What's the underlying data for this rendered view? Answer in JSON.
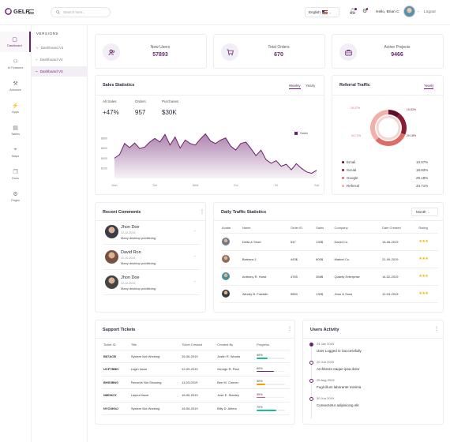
{
  "brand": {
    "name": "GELR",
    "logo_color": "#6b1f6e"
  },
  "header": {
    "search_placeholder": "Search here...",
    "language": "English",
    "greeting": "Hello, Brian C",
    "logout": "Logout"
  },
  "sidebar": {
    "items": [
      {
        "label": "Dashboard",
        "icon": "dashboard-icon",
        "active": true
      },
      {
        "label": "UI Features",
        "icon": "ui-features-icon"
      },
      {
        "label": "Advance",
        "icon": "advance-icon"
      },
      {
        "label": "Apps",
        "icon": "apps-icon"
      },
      {
        "label": "Tables",
        "icon": "tables-icon"
      },
      {
        "label": "Maps",
        "icon": "maps-icon"
      },
      {
        "label": "Docs",
        "icon": "docs-icon"
      },
      {
        "label": "Pages",
        "icon": "pages-icon"
      }
    ],
    "sub_title": "VERSIONS",
    "sub_items": [
      {
        "label": "Dashboard V1"
      },
      {
        "label": "Dashboard V2"
      },
      {
        "label": "Dashboard V3",
        "active": true
      }
    ]
  },
  "stats": [
    {
      "label": "New Users",
      "value": "57893",
      "icon": "users-icon"
    },
    {
      "label": "Total Orders",
      "value": "670",
      "icon": "cart-icon"
    },
    {
      "label": "Active Projects",
      "value": "9466",
      "icon": "briefcase-icon"
    }
  ],
  "sales": {
    "title": "Sales Statistics",
    "tabs": [
      "Weekly",
      "Yearly"
    ],
    "metrics": [
      {
        "label": "All Sales",
        "value": "+47%"
      },
      {
        "label": "Orders",
        "value": "957"
      },
      {
        "label": "Purchases",
        "value": "$30K"
      }
    ],
    "legend": "Sales"
  },
  "chart_data": {
    "type": "area",
    "x": [
      "Mon",
      "Tue",
      "Wed",
      "Thu",
      "Fri",
      "Sat"
    ],
    "y_ticks": [
      "$800",
      "$600",
      "$400",
      "$200"
    ],
    "series": [
      {
        "name": "Sales",
        "values": [
          400,
          470,
          690,
          610,
          700,
          590,
          620,
          720,
          790,
          720,
          870,
          660,
          820,
          600,
          760,
          690,
          660,
          780,
          880,
          740,
          690,
          760,
          800,
          640,
          560,
          690,
          720,
          590,
          450,
          560,
          370,
          300,
          350,
          240,
          280,
          170,
          290,
          200,
          130,
          100,
          160
        ]
      }
    ],
    "ylim": [
      0,
      1000
    ],
    "color": "#6b1f6e"
  },
  "referral": {
    "title": "Referral Traffic",
    "tab": "Yearly",
    "items": [
      {
        "label": "Email",
        "value": "10.07%",
        "color": "#5c0f2e"
      },
      {
        "label": "Social",
        "value": "18.83%",
        "color": "#8a1c35"
      },
      {
        "label": "Google",
        "value": "29.18%",
        "color": "#e06b66"
      },
      {
        "label": "Referral",
        "value": "34.71%",
        "color": "#f2b1a8"
      }
    ],
    "ring_labels": [
      "15.83%",
      "29.18%",
      "34.71%",
      "19.27%"
    ]
  },
  "recent_comments": {
    "title": "Recent Comments",
    "items": [
      {
        "name": "Jhon Doe",
        "date": "12-10-2019",
        "text": "Many desktop publishing"
      },
      {
        "name": "David Ron",
        "date": "12-10-2019",
        "text": "Many desktop publishing"
      },
      {
        "name": "Jhon Doe",
        "date": "12-10-2019",
        "text": "Many desktop publishing"
      }
    ]
  },
  "traffic": {
    "title": "Daily Traffic Statistics",
    "filter": "Month",
    "columns": [
      "Avatar",
      "Name",
      "Order ID",
      "Sales",
      "Company",
      "Date Created",
      "Rating"
    ],
    "rows": [
      {
        "name": "Delta & Short",
        "order": "547",
        "sales": "130$",
        "company": "David Co.",
        "date": "15-06-2019",
        "avatar_color": "#6c7a89"
      },
      {
        "name": "Barbara J.",
        "order": "443$",
        "sales": "600$",
        "company": "Market Co.",
        "date": "21-09-2019",
        "avatar_color": "#8a6d5a"
      },
      {
        "name": "Anthony R. Hurst",
        "order": "4765",
        "sales": "356$",
        "company": "Quanty Enterprise",
        "date": "14-02-2019",
        "avatar_color": "#4a8fa0"
      },
      {
        "name": "Wendy B. Franklin",
        "order": "5550",
        "sales": "130$",
        "company": "Jhon & Sons",
        "date": "12-03-2019",
        "avatar_color": "#3a3a3a"
      }
    ],
    "rating": "★★★"
  },
  "tickets": {
    "title": "Support Tickets",
    "columns": [
      "Ticket ID",
      "Title",
      "Ticket Created",
      "Created By",
      "Progress"
    ],
    "rows": [
      {
        "id": "B87ACB",
        "title": "System Not Working",
        "created": "16-06-2019",
        "by": "Justin R. Woods",
        "progress": "40%",
        "pct": 0.4,
        "color": "#1bbc9b"
      },
      {
        "id": "UCF7BBH",
        "title": "Login Issue",
        "created": "12-09-2019",
        "by": "George R. Paul",
        "progress": "60%",
        "pct": 0.6,
        "color": "#6b1f6e"
      },
      {
        "id": "BHS3BN0",
        "title": "Records Not Showing",
        "created": "11-03-2019",
        "by": "Bee M. Conner",
        "progress": "30%",
        "pct": 0.3,
        "color": "#f4a100"
      },
      {
        "id": "N8E0IOY",
        "title": "Layout Issue",
        "created": "16-06-2019",
        "by": "Jose E. Stanley",
        "progress": "30%",
        "pct": 0.3,
        "color": "#e0497a"
      },
      {
        "id": "NYO3KNJ",
        "title": "System Not Working",
        "created": "16-06-2019",
        "by": "Billy D. Ahlers",
        "progress": "70%",
        "pct": 0.7,
        "color": "#1bbc9b"
      }
    ]
  },
  "activity": {
    "title": "Users Activity",
    "items": [
      {
        "date": "24 Jan 2019",
        "text": "User Logged in Successfully"
      },
      {
        "date": "20 Jun 2019",
        "text": "Architecto eaque ipsa dolor"
      },
      {
        "date": "25 Aug 2019",
        "text": "Fugit illum laborante minima"
      },
      {
        "date": "30 Jun 2019",
        "text": "Consectetur adipisicing elit"
      }
    ]
  }
}
